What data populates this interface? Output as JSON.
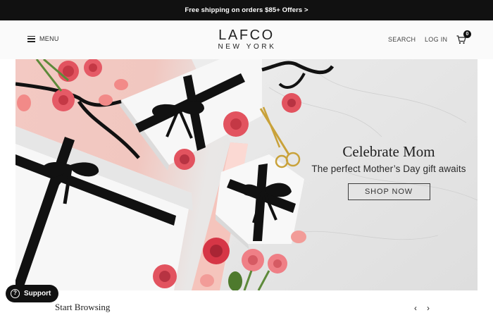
{
  "announcement": {
    "text": "Free shipping on orders $85+ Offers >"
  },
  "header": {
    "menu_label": "MENU",
    "logo_line1": "LAFCO",
    "logo_line2": "NEW YORK",
    "search_label": "SEARCH",
    "login_label": "LOG IN",
    "cart_count": "0"
  },
  "hero": {
    "title": "Celebrate Mom",
    "subtitle": "The perfect Mother’s Day gift awaits",
    "cta_label": "SHOP NOW"
  },
  "support": {
    "label": "Support"
  },
  "section": {
    "title": "Start Browsing",
    "prev_icon": "chevron-left-icon",
    "next_icon": "chevron-right-icon"
  },
  "colors": {
    "announce_bg": "#111111",
    "header_bg": "#fafafa",
    "pink": "#f3c9c3",
    "marble": "#e4e4e4",
    "rose": "#e2535f"
  }
}
